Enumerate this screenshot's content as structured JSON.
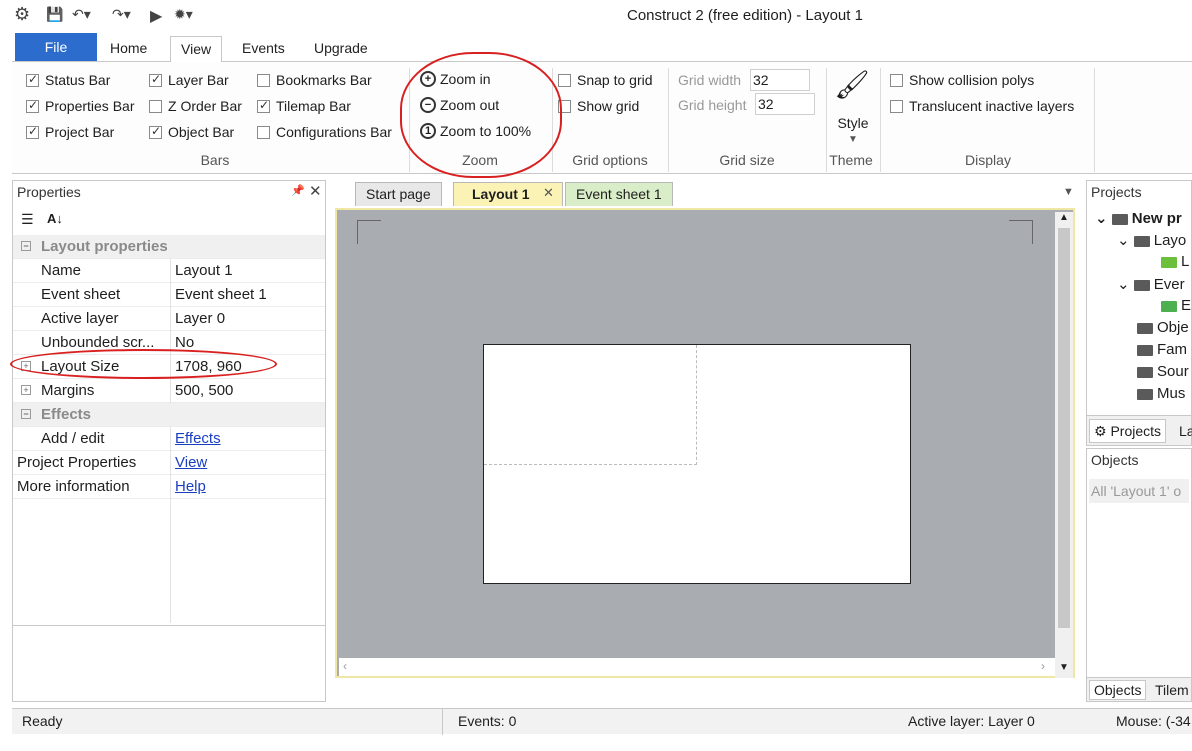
{
  "window": {
    "title": "Construct 2  (free edition) - Layout 1"
  },
  "ribbon_tabs": [
    "File",
    "Home",
    "View",
    "Events",
    "Upgrade"
  ],
  "bars_group": {
    "label": "Bars",
    "items": [
      {
        "label": "Status Bar",
        "checked": true
      },
      {
        "label": "Properties Bar",
        "checked": true
      },
      {
        "label": "Project Bar",
        "checked": true
      },
      {
        "label": "Layer Bar",
        "checked": true
      },
      {
        "label": "Z Order Bar",
        "checked": false
      },
      {
        "label": "Object Bar",
        "checked": true
      },
      {
        "label": "Bookmarks Bar",
        "checked": false
      },
      {
        "label": "Tilemap Bar",
        "checked": true
      },
      {
        "label": "Configurations Bar",
        "checked": false
      }
    ]
  },
  "zoom_group": {
    "label": "Zoom",
    "zoom_in": "Zoom in",
    "zoom_out": "Zoom out",
    "zoom_100": "Zoom to 100%"
  },
  "grid_options": {
    "label": "Grid options",
    "snap": "Snap to grid",
    "show": "Show grid"
  },
  "grid_size": {
    "label": "Grid size",
    "width_label": "Grid width",
    "width_value": "32",
    "height_label": "Grid height",
    "height_value": "32"
  },
  "theme": {
    "label": "Theme",
    "style": "Style"
  },
  "display_group": {
    "label": "Display",
    "collision": "Show collision polys",
    "translucent": "Translucent inactive layers"
  },
  "properties_panel": {
    "title": "Properties",
    "section_layout": "Layout properties",
    "rows": [
      {
        "key": "Name",
        "value": "Layout 1"
      },
      {
        "key": "Event sheet",
        "value": "Event sheet 1"
      },
      {
        "key": "Active layer",
        "value": "Layer 0"
      },
      {
        "key": "Unbounded scr...",
        "value": "No"
      },
      {
        "key": "Layout Size",
        "value": "1708, 960"
      },
      {
        "key": "Margins",
        "value": "500, 500"
      }
    ],
    "section_effects": "Effects",
    "add_edit": "Add / edit",
    "effects_link": "Effects",
    "project_properties": "Project Properties",
    "view_link": "View",
    "more_info": "More information",
    "help_link": "Help"
  },
  "editor_tabs": [
    "Start page",
    "Layout 1",
    "Event sheet 1"
  ],
  "projects_panel": {
    "title": "Projects",
    "tree": [
      "New pr",
      "Layo",
      "L",
      "Ever",
      "E",
      "Obje",
      "Fam",
      "Sour",
      "Mus"
    ],
    "tab_projects": "Projects",
    "tab_layers": "La"
  },
  "objects_panel": {
    "title": "Objects",
    "filter_placeholder": "All 'Layout 1' o",
    "tab_objects": "Objects",
    "tab_tilemap": "Tilem"
  },
  "status_bar": {
    "ready": "Ready",
    "events": "Events: 0",
    "active_layer": "Active layer: Layer 0",
    "mouse": "Mouse: (-34"
  }
}
